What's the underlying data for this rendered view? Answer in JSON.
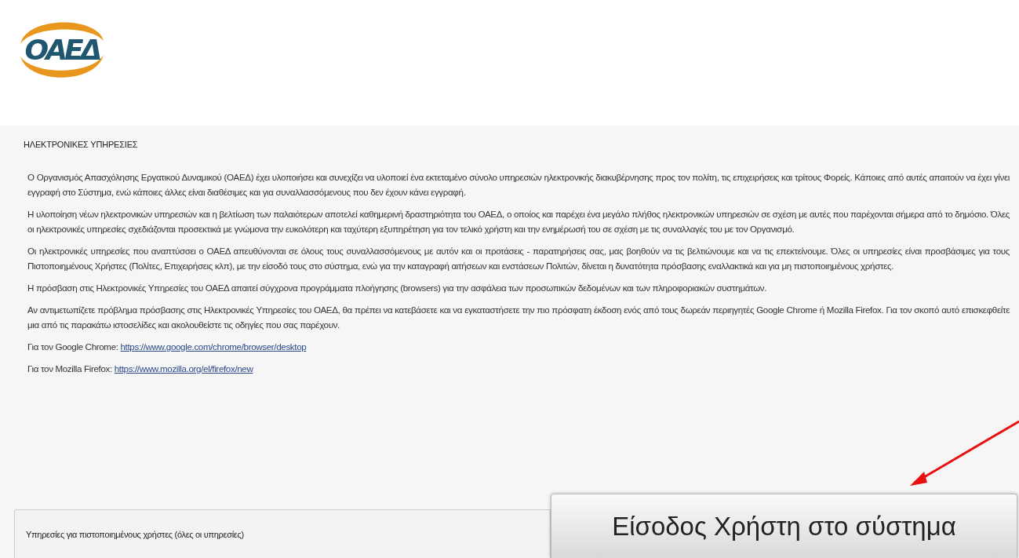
{
  "logo": {
    "text": "ΟΑΕΔ"
  },
  "heading": "ΗΛΕΚΤΡΟΝΙΚΕΣ ΥΠΗΡΕΣΙΕΣ",
  "paragraphs": [
    {
      "text": "Ο Οργανισμός Απασχόλησης Εργατικού Δυναμικού (ΟΑΕΔ) έχει υλοποιήσει και συνεχίζει να υλοποιεί ένα εκτεταμένο σύνολο υπηρεσιών ηλεκτρονικής διακυβέρνησης προς τον πολίτη, τις επιχειρήσεις και τρίτους Φορείς. Κάποιες από αυτές απαιτούν να έχει γίνει εγγραφή στο Σύστημα, ενώ κάποιες άλλες είναι διαθέσιμες και για συναλλασσόμενους που δεν έχουν κάνει εγγραφή."
    },
    {
      "text": "Η υλοποίηση νέων ηλεκτρονικών υπηρεσιών και η βελτίωση των παλαιότερων αποτελεί καθημερινή δραστηριότητα του ΟΑΕΔ, ο οποίος και παρέχει ένα μεγάλο πλήθος ηλεκτρονικών υπηρεσιών σε σχέση με αυτές που παρέχονται σήμερα από το δημόσιο. Όλες οι ηλεκτρονικές υπηρεσίες σχεδιάζονται προσεκτικά με γνώμονα την ευκολότερη και ταχύτερη εξυπηρέτηση για τον τελικό χρήστη και την ενημέρωσή του σε σχέση με τις συναλλαγές του με τον Οργανισμό."
    },
    {
      "text": "Οι ηλεκτρονικές υπηρεσίες που αναπτύσσει ο ΟΑΕΔ απευθύνονται σε όλους τους συναλλασσόμενους με αυτόν και οι προτάσεις - παρατηρήσεις σας, μας βοηθούν να τις βελτιώνουμε και να τις επεκτείνουμε. Όλες οι υπηρεσίες είναι προσβάσιμες για τους Πιστοποιημένους Χρήστες (Πολίτες, Επιχειρήσεις κλπ), με την είσοδό τους στο σύστημα, ενώ για την καταγραφή αιτήσεων και ενστάσεων Πολιτών, δίνεται η δυνατότητα πρόσβασης εναλλακτικά και για μη πιστοποιημένους χρήστες."
    },
    {
      "text": "Η πρόσβαση στις Ηλεκτρονικές Υπηρεσίες του ΟΑΕΔ απαιτεί σύγχρονα προγράμματα πλοήγησης (browsers) για την ασφάλεια των προσωπικών δεδομένων και των πληροφοριακών συστημάτων."
    },
    {
      "text": "Αν αντιμετωπίζετε πρόβλημα πρόσβασης στις Ηλεκτρονικές Υπηρεσίες του ΟΑΕΔ, θα πρέπει να κατεβάσετε και να εγκαταστήσετε την πιο πρόσφατη έκδοση ενός από τους δωρεάν περιηγητές Google Chrome ή Mozilla Firefox. Για τον σκοπό αυτό επισκεφθείτε μια από τις παρακάτω ιστοσελίδες και ακολουθείστε τις οδηγίες που σας παρέχουν."
    },
    {
      "text": "Για τον Google Chrome:",
      "link": "https://www.google.com/chrome/browser/desktop"
    },
    {
      "text": "Για τον Mozilla Firefox:",
      "link": "https://www.mozilla.org/el/firefox/new"
    }
  ],
  "services_panel": {
    "title": "Υπηρεσίες για πιστοποιημένους χρήστες (όλες οι υπηρεσίες)"
  },
  "login_button": {
    "label": "Είσοδος Χρήστη στο σύστημα"
  }
}
